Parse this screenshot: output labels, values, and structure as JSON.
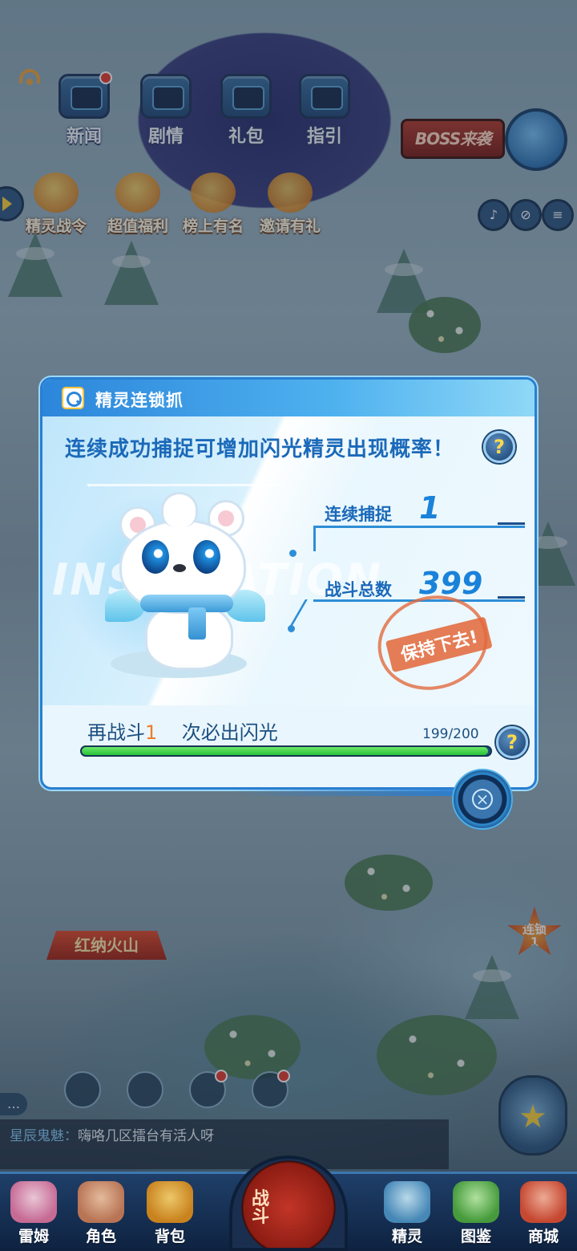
{
  "top_menu": {
    "items": [
      {
        "label": "新闻",
        "badge": true
      },
      {
        "label": "剧情",
        "badge": false
      },
      {
        "label": "礼包",
        "badge": false
      },
      {
        "label": "指引",
        "badge": false
      }
    ],
    "activities": [
      {
        "label": "精灵战令"
      },
      {
        "label": "超值福利"
      },
      {
        "label": "榜上有名"
      },
      {
        "label": "邀请有礼"
      }
    ],
    "boss_sign": "BOSS来袭"
  },
  "scene": {
    "volcano_label": "红纳火山",
    "streak_badge": "连锁\n1"
  },
  "dialog": {
    "title": "精灵连锁抓",
    "slogan": "连续成功捕捉可增加闪光精灵出现概率！",
    "watermark": "INSPIRATION",
    "help_symbol": "?",
    "capture_label": "连续捕捉",
    "capture_value": "1",
    "battles_label": "战斗总数",
    "battles_value": "399",
    "stamp_text": "保持下去!",
    "progress_prefix": "再战斗",
    "progress_number": "1",
    "progress_suffix": "次必出闪光",
    "progress_count": "199/200",
    "progress_fraction": 0.995,
    "close_symbol": "×"
  },
  "chat": {
    "speaker": "星辰鬼魅：",
    "message": "嗨咯几区擂台有活人呀"
  },
  "bottom_nav": {
    "items": [
      {
        "label": "雷姆"
      },
      {
        "label": "角色"
      },
      {
        "label": "背包"
      },
      {
        "label": "精灵"
      },
      {
        "label": "图鉴"
      },
      {
        "label": "商城"
      }
    ],
    "fight_label": "战斗"
  },
  "colors": {
    "accent_blue": "#2a7ed0",
    "progress_green": "#27c237",
    "highlight_orange": "#f07b2a"
  }
}
